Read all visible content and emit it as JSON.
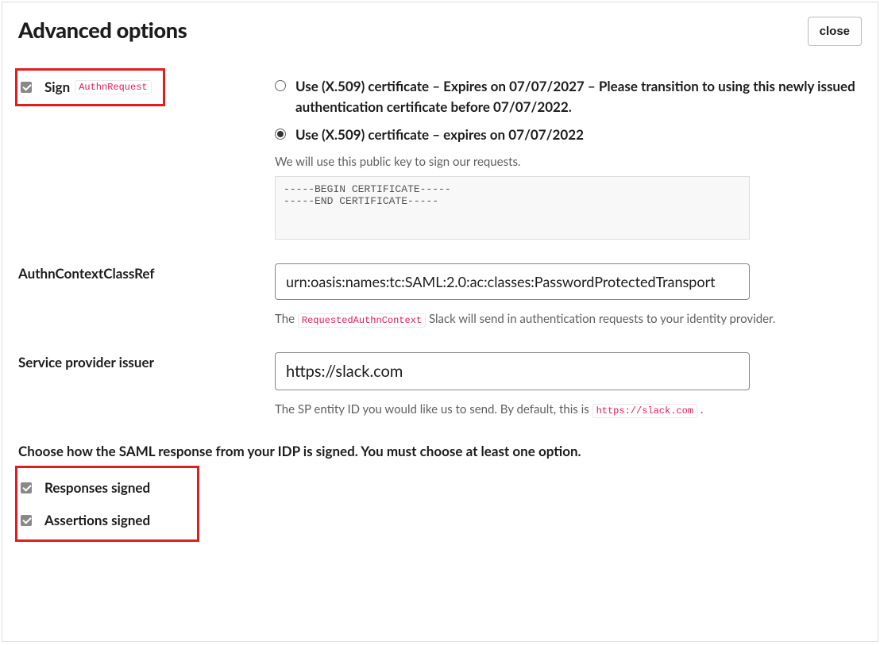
{
  "header": {
    "title": "Advanced options",
    "close_label": "close"
  },
  "sign_authn": {
    "label_prefix": "Sign",
    "code_tag": "AuthnRequest",
    "radios": {
      "opt1": "Use (X.509) certificate – Expires on 07/07/2027 – Please transition to using this newly issued authentication certificate before 07/07/2022.",
      "opt2": "Use (X.509) certificate – expires on 07/07/2022"
    },
    "helper": "We will use this public key to sign our requests.",
    "cert_text": "-----BEGIN CERTIFICATE-----\n-----END CERTIFICATE-----"
  },
  "authn_context": {
    "label": "AuthnContextClassRef",
    "value": "urn:oasis:names:tc:SAML:2.0:ac:classes:PasswordProtectedTransport",
    "helper_prefix": "The ",
    "helper_code": "RequestedAuthnContext",
    "helper_suffix": " Slack will send in authentication requests to your identity provider."
  },
  "sp_issuer": {
    "label": "Service provider issuer",
    "value": "https://slack.com",
    "helper_prefix": "The SP entity ID you would like us to send. By default, this is ",
    "helper_code": "https://slack.com",
    "helper_suffix": "."
  },
  "signing": {
    "instruction": "Choose how the SAML response from your IDP is signed. You must choose at least one option.",
    "responses_label": "Responses signed",
    "assertions_label": "Assertions signed"
  }
}
